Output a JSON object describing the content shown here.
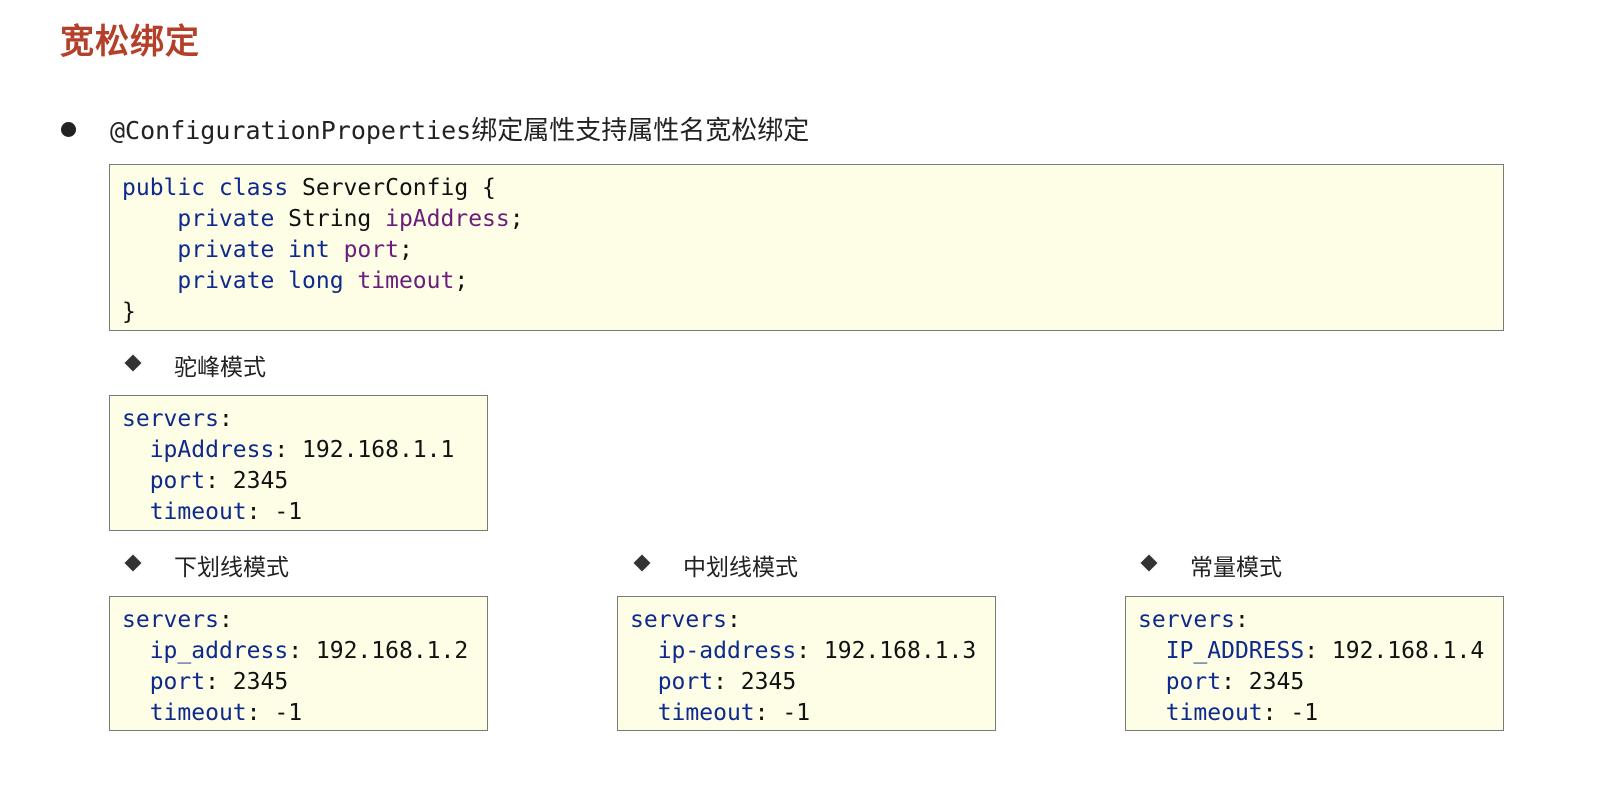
{
  "title": "宽松绑定",
  "bullet": {
    "code_part": "@ConfigurationProperties",
    "text_part": "绑定属性支持属性名宽松绑定"
  },
  "java_code": {
    "line1": {
      "kw": "public class",
      "rest": " ServerConfig {"
    },
    "line2": {
      "kw": "private",
      "type": " String ",
      "field": "ipAddress",
      "end": ";"
    },
    "line3": {
      "kw1": "private",
      "kw2": " int ",
      "field": "port",
      "end": ";"
    },
    "line4": {
      "kw1": "private",
      "kw2": " long ",
      "field": "timeout",
      "end": ";"
    },
    "line5": "}"
  },
  "sections": [
    {
      "label": "驼峰模式",
      "root": "servers",
      "ip_key": "ipAddress",
      "ip_value": "192.168.1.1",
      "port_key": "port",
      "port_value": "2345",
      "timeout_key": "timeout",
      "timeout_value": "-1"
    },
    {
      "label": "下划线模式",
      "root": "servers",
      "ip_key": "ip_address",
      "ip_value": "192.168.1.2",
      "port_key": "port",
      "port_value": "2345",
      "timeout_key": "timeout",
      "timeout_value": "-1"
    },
    {
      "label": "中划线模式",
      "root": "servers",
      "ip_key": "ip-address",
      "ip_value": "192.168.1.3",
      "port_key": "port",
      "port_value": "2345",
      "timeout_key": "timeout",
      "timeout_value": "-1"
    },
    {
      "label": "常量模式",
      "root": "servers",
      "ip_key": "IP_ADDRESS",
      "ip_value": "192.168.1.4",
      "port_key": "port",
      "port_value": "2345",
      "timeout_key": "timeout",
      "timeout_value": "-1"
    }
  ]
}
